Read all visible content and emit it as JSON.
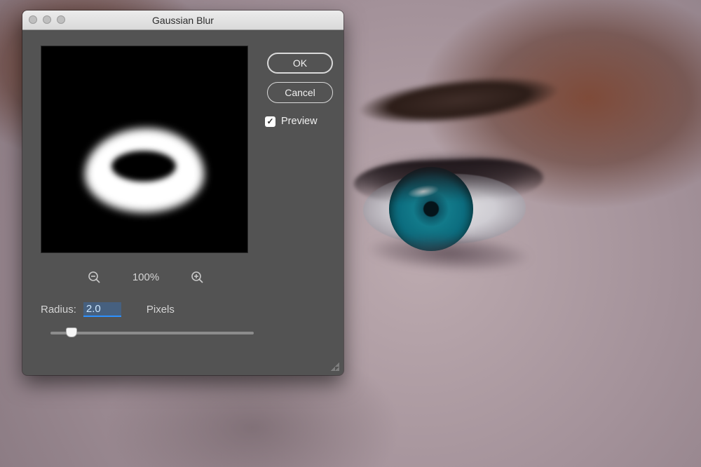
{
  "dialog": {
    "title": "Gaussian Blur",
    "ok_label": "OK",
    "cancel_label": "Cancel",
    "preview_label": "Preview",
    "preview_checked": true,
    "zoom_level": "100%",
    "radius_label": "Radius:",
    "radius_value": "2.0",
    "radius_unit": "Pixels"
  },
  "icons": {
    "zoom_out": "⊖",
    "zoom_in": "⊕",
    "checkmark": "✓"
  }
}
